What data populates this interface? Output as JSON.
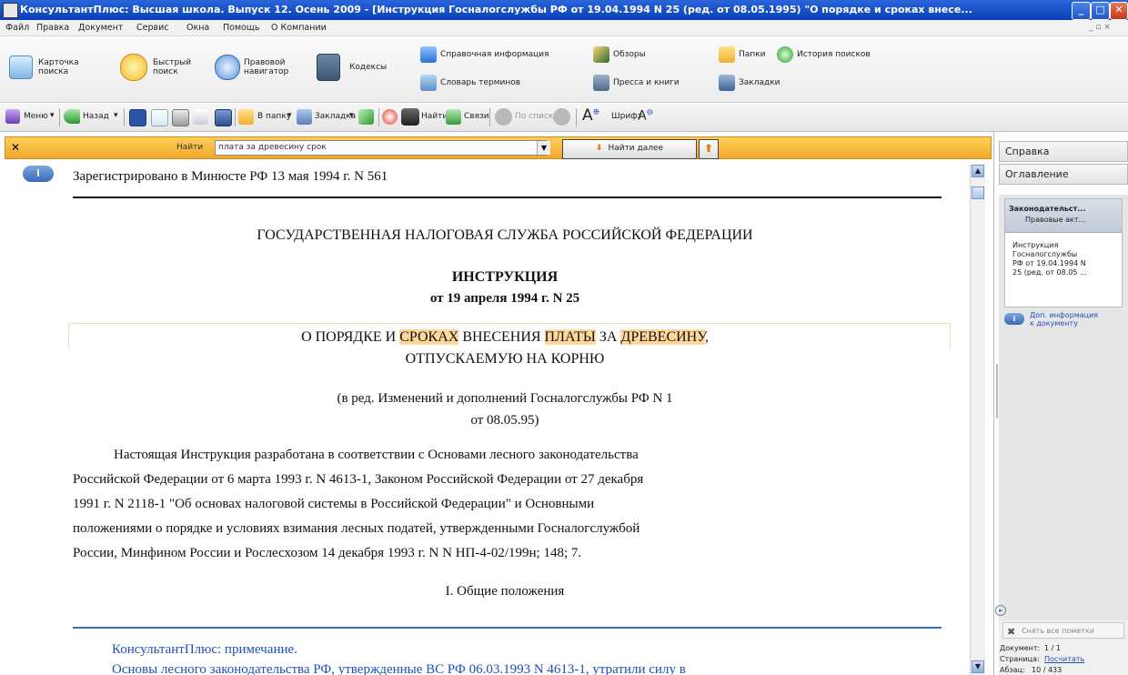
{
  "window": {
    "title": "КонсультантПлюс: Высшая школа. Выпуск 12. Осень 2009 - [Инструкция Госналогслужбы РФ от 19.04.1994 N 25 (ред. от 08.05.1995) \"О порядке и сроках внесе...",
    "buttons": [
      "_",
      "□",
      "✕"
    ]
  },
  "menu": {
    "items": [
      "Файл",
      "Правка",
      "Документ",
      "Сервис",
      "Окна",
      "Помощь",
      "О Компании"
    ],
    "mdi_controls": "_ ▫ ×"
  },
  "big_toolbar": {
    "card_search": "Карточка поиска",
    "quick_search": "Быстрый поиск",
    "legal_navigator": "Правовой навигатор",
    "codes": "Кодексы",
    "reference_info": "Справочная информация",
    "reviews": "Обзоры",
    "folders": "Папки",
    "search_history": "История поисков",
    "dictionary": "Словарь терминов",
    "press_books": "Пресса и книги",
    "bookmarks": "Закладки"
  },
  "small_toolbar": {
    "menu": "Меню",
    "back": "Назад",
    "to_folder": "В папку",
    "bookmark": "Закладка",
    "find": "Найти",
    "links": "Связи",
    "by_list": "По списку",
    "font": "Шрифт"
  },
  "find_bar": {
    "label": "Найти",
    "value": "плата за древесину срок",
    "button": "Найти далее"
  },
  "document": {
    "registration": "Зарегистрировано в Минюсте РФ 13 мая 1994 г. N 561",
    "agency": "ГОСУДАРСТВЕННАЯ НАЛОГОВАЯ СЛУЖБА РОССИЙСКОЙ ФЕДЕРАЦИИ",
    "doc_type": "ИНСТРУКЦИЯ",
    "doc_date": "от 19 апреля 1994 г. N 25",
    "title_parts": [
      "О ПОРЯДКЕ И ",
      "СРОКАХ",
      " ВНЕСЕНИЯ ",
      "ПЛАТЫ",
      " ЗА ",
      "ДРЕВЕСИНУ",
      ","
    ],
    "title_line2": "ОТПУСКАЕМУЮ НА КОРНЮ",
    "revision_line1": "(в ред. Изменений и дополнений Госналогслужбы РФ N 1",
    "revision_line2": "от 08.05.95)",
    "body_lines": [
      "Настоящая Инструкция разработана в соответствии с Основами лесного законодательства",
      "Российской Федерации от 6 марта 1993 г. N 4613-1, Законом Российской Федерации от 27 декабря",
      "1991 г. N 2118-1 \"Об основах налоговой системы в Российской Федерации\" и Основными",
      "положениями о порядке и условиях взимания лесных податей, утвержденными Госналогслужбой",
      "России, Минфином России и Рослесхозом 14 декабря 1993 г. N N НП-4-02/199н; 148; 7."
    ],
    "section_heading": "I. Общие положения",
    "note_heading": "КонсультантПлюс: примечание.",
    "note_text": "Основы лесного законодательства РФ, утвержденные ВС РФ 06.03.1993 N 4613-1, утратили силу в"
  },
  "right_panel": {
    "tab_help": "Справка",
    "tab_contents": "Оглавление",
    "box_header_line1": "Законодательст...",
    "box_header_line2": "Правовые акт...",
    "box_body": [
      "Инструкция",
      "Госналогслужбы",
      "РФ от 19.04.1994 N",
      "25 (ред. от 08.05 ..."
    ],
    "extra_info": [
      "Доп. информация",
      "к документу"
    ],
    "clear_marks": "Снять все пометки",
    "status": {
      "doc_label": "Документ:",
      "doc_value": "1 / 1",
      "page_label": "Страница:",
      "page_value": "Посчитать",
      "para_label": "Абзац:",
      "para_value": "10 / 433"
    }
  },
  "colors": {
    "titlebar": "#0a3fb8",
    "findbar": "#f5b43e",
    "highlight": "#ffd79b",
    "link": "#1f4fb8",
    "rule": "#3070c8"
  }
}
